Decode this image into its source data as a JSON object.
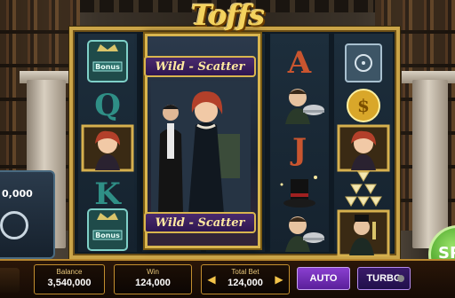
{
  "game": {
    "logo": "Toffs"
  },
  "wild_symbol": {
    "banner_top": "Wild - Scatter",
    "banner_bottom": "Wild - Scatter"
  },
  "reels": [
    [
      "bonus-crown-icon",
      "Q",
      "lady-portrait-icon",
      "K",
      "bonus-crown-icon"
    ],
    [
      "wild-scatter",
      "wild-scatter",
      "wild-scatter",
      "wild-scatter",
      "wild-scatter"
    ],
    [
      "A",
      "butler-icon",
      "J",
      "top-hat-icon",
      "butler-icon"
    ],
    [
      "safe-icon",
      "gold-coin-icon",
      "lady-portrait-icon",
      "champagne-tower-icon",
      "gentleman-portrait-icon"
    ]
  ],
  "side_vault": {
    "amount": "0,000"
  },
  "bottom_bar": {
    "balance_label": "Balance",
    "balance_value": "3,540,000",
    "win_label": "Win",
    "win_value": "124,000",
    "total_bet_label": "Total Bet",
    "total_bet_value": "124,000",
    "auto_label": "AUTO",
    "turbo_label": "TURBO"
  },
  "spin_button": {
    "label": "SP"
  },
  "colors": {
    "gold": "#caa448",
    "letter_q_k": "#2f8f86",
    "letter_a_j": "#c9552f",
    "auto_purple": "#8a3fd0",
    "spin_green": "#3e9a1f"
  }
}
